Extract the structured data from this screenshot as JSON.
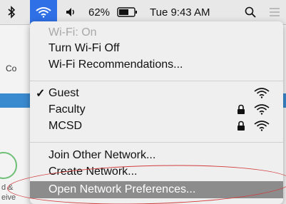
{
  "menubar": {
    "battery_percent": "62%",
    "clock": "Tue 9:43 AM",
    "icons": [
      "bluetooth-icon",
      "wifi-icon",
      "volume-icon",
      "battery-icon",
      "search-icon",
      "list-icon"
    ]
  },
  "background": {
    "partial_label": "Co",
    "text_line1": "d &",
    "text_line2": "eive"
  },
  "menu": {
    "status": "Wi-Fi: On",
    "turn_off": "Turn Wi-Fi Off",
    "recommendations": "Wi-Fi Recommendations...",
    "networks": [
      {
        "name": "Guest",
        "connected": true,
        "locked": false
      },
      {
        "name": "Faculty",
        "connected": false,
        "locked": true
      },
      {
        "name": "MCSD",
        "connected": false,
        "locked": true
      }
    ],
    "join_other": "Join Other Network...",
    "create_network": "Create Network...",
    "open_prefs": "Open Network Preferences..."
  },
  "colors": {
    "wifi_active": "#2f70e6",
    "highlight": "#8c8c8c",
    "annotation": "#d23c3c"
  }
}
